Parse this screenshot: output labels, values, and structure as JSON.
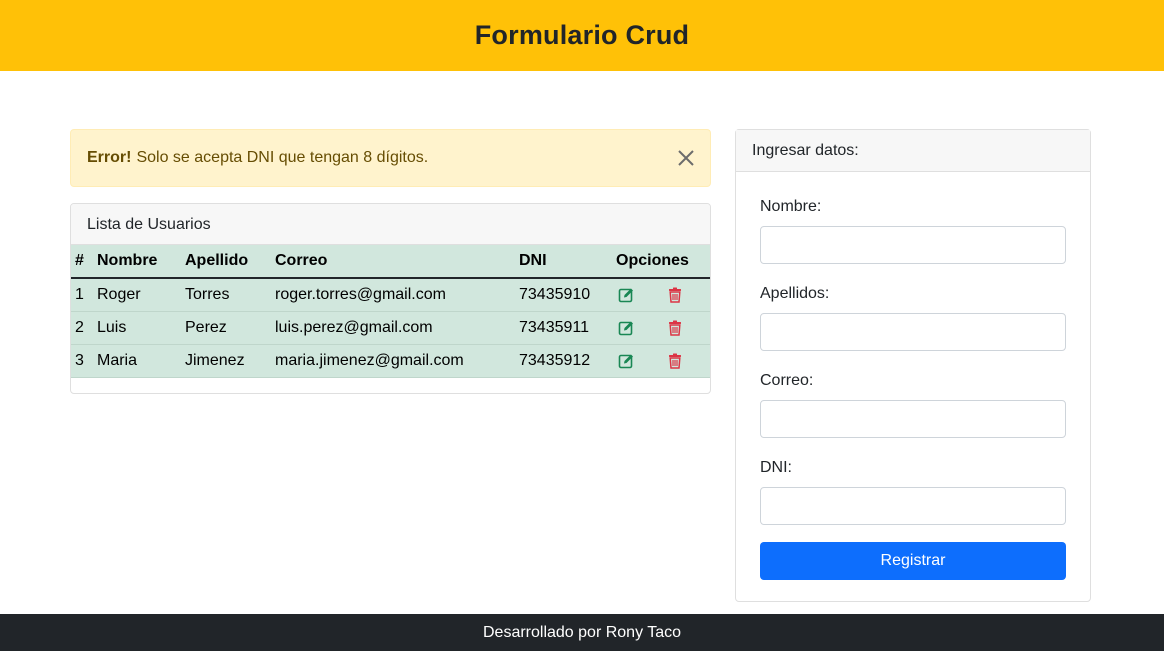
{
  "header": {
    "title": "Formulario Crud"
  },
  "alert": {
    "strong": "Error!",
    "message": "Solo se acepta DNI que tengan 8 dígitos."
  },
  "list": {
    "title": "Lista de Usuarios",
    "columns": [
      "#",
      "Nombre",
      "Apellido",
      "Correo",
      "DNI",
      "Opciones"
    ],
    "rows": [
      {
        "num": "1",
        "nombre": "Roger",
        "apellido": "Torres",
        "correo": "roger.torres@gmail.com",
        "dni": "73435910"
      },
      {
        "num": "2",
        "nombre": "Luis",
        "apellido": "Perez",
        "correo": "luis.perez@gmail.com",
        "dni": "73435911"
      },
      {
        "num": "3",
        "nombre": "Maria",
        "apellido": "Jimenez",
        "correo": "maria.jimenez@gmail.com",
        "dni": "73435912"
      }
    ]
  },
  "form": {
    "title": "Ingresar datos:",
    "fields": [
      {
        "label": "Nombre:",
        "value": ""
      },
      {
        "label": "Apellidos:",
        "value": ""
      },
      {
        "label": "Correo:",
        "value": ""
      },
      {
        "label": "DNI:",
        "value": ""
      }
    ],
    "submit_label": "Registrar"
  },
  "footer": {
    "text": "Desarrollado por Rony Taco"
  },
  "icons": {
    "edit": "edit-icon",
    "delete": "trash-icon",
    "close": "close-icon"
  },
  "colors": {
    "header_bg": "#ffc107",
    "alert_bg": "#fff3cd",
    "row_bg": "#d1e7dd",
    "edit": "#198754",
    "delete": "#dc3545",
    "primary": "#0d6efd",
    "footer_bg": "#212529"
  }
}
